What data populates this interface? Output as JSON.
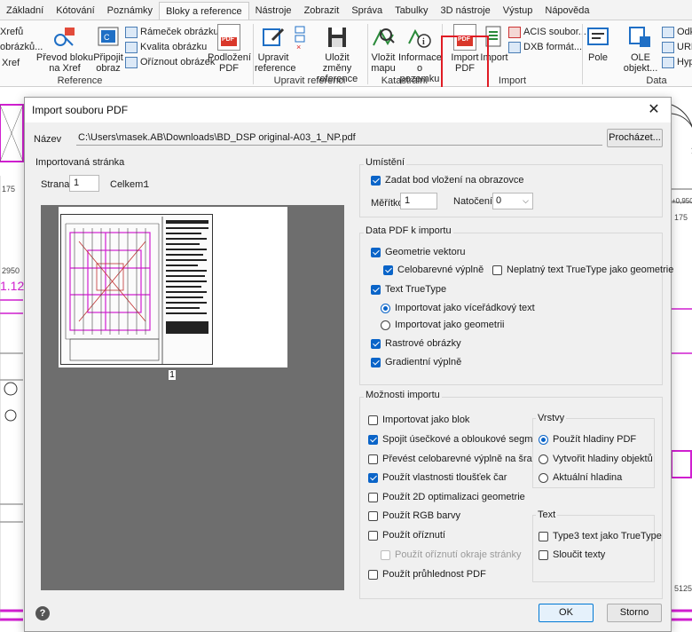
{
  "ribbon": {
    "tabs": [
      "Základní",
      "Kótování",
      "Poznámky",
      "Bloky a reference",
      "Nástroje",
      "Zobrazit",
      "Správa",
      "Tabulky",
      "3D nástroje",
      "Výstup",
      "Nápověda"
    ],
    "active_tab": "Bloky a reference",
    "buttons": {
      "xref_top": "Xrefů",
      "xref_mid": "obrázků...",
      "xref_bottom": "Xref",
      "prevod": "Převod bloku na Xref",
      "pripojit": "Připojit obraz",
      "ramecek": "Rámeček obrázku",
      "kvalita": "Kvalita obrázku",
      "oriznout": "Oříznout obrázek",
      "podlozeni": "Podložení PDF",
      "upravit_ref": "Upravit reference",
      "ulozit_zmeny": "Uložit změny reference",
      "vlozit_mapu": "Vložit mapu",
      "informace": "Informace o pozemku",
      "import_pdf": "Import PDF",
      "import": "Import",
      "acis": "ACIS soubor...",
      "dxb": "DXB formát...",
      "pole": "Pole",
      "ole": "OLE objekt...",
      "odk": "Odk",
      "url": "URL",
      "hyp": "Hyp"
    },
    "groups": {
      "reference": "Reference",
      "upravit_referenci": "Upravit referenci",
      "katastralni_mapa": "Katastrální mapa",
      "import": "Import",
      "data": "Data"
    }
  },
  "cad": {
    "left_texts": [
      "175",
      "2950",
      "1.12"
    ],
    "right_texts": [
      "+0,950",
      "175",
      "5125"
    ]
  },
  "dialog": {
    "title": "Import souboru PDF",
    "name_label": "Název",
    "file_path": "C:\\Users\\masek.AB\\Downloads\\BD_DSP original-A03_1_NP.pdf",
    "browse_label": "Procházet...",
    "imported_page": {
      "title": "Importovaná stránka",
      "page_label": "Strana",
      "page_value": "1",
      "total_label": "Celkem:",
      "total_value": "1",
      "thumb_page_number": "1"
    },
    "placement": {
      "title": "Umístění",
      "specify_point": "Zadat bod vložení na obrazovce",
      "scale_label": "Měřítko",
      "scale_value": "1",
      "rotation_label": "Natočení:",
      "rotation_value": "0"
    },
    "pdf_data": {
      "title": "Data PDF k importu",
      "vector_geometry": "Geometrie vektoru",
      "solid_fills": "Celobarevné výplně",
      "invalid_truetype": "Neplatný text TrueType jako geometrie",
      "truetype_text": "Text TrueType",
      "as_multiline": "Importovat jako víceřádkový text",
      "as_geometry": "Importovat jako geometrii",
      "raster_images": "Rastrové obrázky",
      "gradient_fills": "Gradientní výplně"
    },
    "import_options": {
      "title": "Možnosti importu",
      "as_block": "Importovat jako blok",
      "join_segments": "Spojit úsečkové a obloukové segmenty",
      "convert_fills": "Převést celobarevné výplně na šrafy",
      "lineweights": "Použít vlastnosti tloušťek čar",
      "optimize_2d": "Použít 2D optimalizaci geometrie",
      "rgb_colors": "Použít RGB barvy",
      "clipping": "Použít oříznutí",
      "page_clip": "Použít oříznutí okraje stránky",
      "transparency": "Použít průhlednost PDF"
    },
    "layers": {
      "title": "Vrstvy",
      "pdf_layers": "Použít hladiny PDF",
      "object_layers": "Vytvořit hladiny objektů",
      "current_layer": "Aktuální hladina"
    },
    "text": {
      "title": "Text",
      "type3_as_truetype": "Type3 text jako TrueType",
      "merge_texts": "Sloučit texty"
    },
    "ok_label": "OK",
    "cancel_label": "Storno",
    "help_label": "?"
  }
}
